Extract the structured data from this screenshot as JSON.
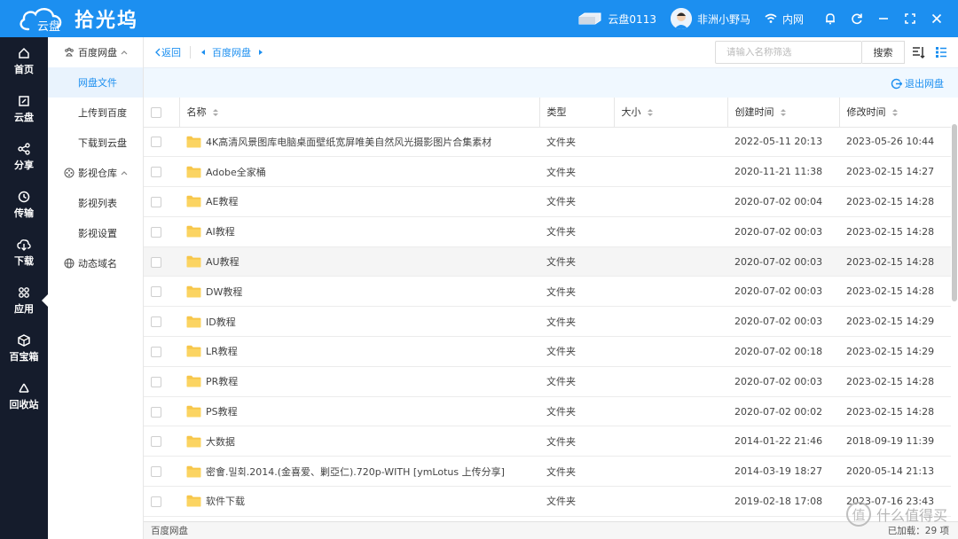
{
  "app": {
    "logo_text": "云盘",
    "title": "拾光坞"
  },
  "topbar": {
    "device_name": "云盘0113",
    "user_name": "非洲小野马",
    "network": "内网"
  },
  "leftnav": [
    {
      "label": "首页",
      "icon": "home-icon"
    },
    {
      "label": "云盘",
      "icon": "cloud-disk-icon"
    },
    {
      "label": "分享",
      "icon": "share-icon"
    },
    {
      "label": "传输",
      "icon": "transfer-icon"
    },
    {
      "label": "下载",
      "icon": "download-icon"
    },
    {
      "label": "应用",
      "icon": "apps-icon"
    },
    {
      "label": "百宝箱",
      "icon": "toolbox-icon"
    },
    {
      "label": "回收站",
      "icon": "recycle-icon"
    }
  ],
  "subnav": {
    "group1": "百度网盘",
    "items1": [
      "网盘文件",
      "上传到百度",
      "下载到云盘"
    ],
    "group2": "影视仓库",
    "items2": [
      "影视列表",
      "影视设置"
    ],
    "group3": "动态域名"
  },
  "toolbar": {
    "back": "返回",
    "crumb": "百度网盘",
    "search_placeholder": "请输入名称筛选",
    "search_button": "搜索",
    "exit_link": "退出网盘"
  },
  "table": {
    "headers": {
      "name": "名称",
      "type": "类型",
      "size": "大小",
      "created": "创建时间",
      "modified": "修改时间"
    },
    "rows": [
      {
        "name": "4K高清风景图库电脑桌面壁纸宽屏唯美自然风光摄影图片合集素材",
        "type": "文件夹",
        "size": "",
        "created": "2022-05-11 20:13",
        "modified": "2023-05-26 10:44"
      },
      {
        "name": "Adobe全家桶",
        "type": "文件夹",
        "size": "",
        "created": "2020-11-21 11:38",
        "modified": "2023-02-15 14:27"
      },
      {
        "name": "AE教程",
        "type": "文件夹",
        "size": "",
        "created": "2020-07-02 00:04",
        "modified": "2023-02-15 14:28"
      },
      {
        "name": "AI教程",
        "type": "文件夹",
        "size": "",
        "created": "2020-07-02 00:03",
        "modified": "2023-02-15 14:28"
      },
      {
        "name": "AU教程",
        "type": "文件夹",
        "size": "",
        "created": "2020-07-02 00:03",
        "modified": "2023-02-15 14:28"
      },
      {
        "name": "DW教程",
        "type": "文件夹",
        "size": "",
        "created": "2020-07-02 00:03",
        "modified": "2023-02-15 14:28"
      },
      {
        "name": "ID教程",
        "type": "文件夹",
        "size": "",
        "created": "2020-07-02 00:03",
        "modified": "2023-02-15 14:29"
      },
      {
        "name": "LR教程",
        "type": "文件夹",
        "size": "",
        "created": "2020-07-02 00:18",
        "modified": "2023-02-15 14:29"
      },
      {
        "name": "PR教程",
        "type": "文件夹",
        "size": "",
        "created": "2020-07-02 00:03",
        "modified": "2023-02-15 14:28"
      },
      {
        "name": "PS教程",
        "type": "文件夹",
        "size": "",
        "created": "2020-07-02 00:02",
        "modified": "2023-02-15 14:28"
      },
      {
        "name": "大数据",
        "type": "文件夹",
        "size": "",
        "created": "2014-01-22 21:46",
        "modified": "2018-09-19 11:39"
      },
      {
        "name": "密會.밀회.2014.(金喜爱、剿亞仁).720p-WITH [ymLotus 上传分享]",
        "type": "文件夹",
        "size": "",
        "created": "2014-03-19 18:27",
        "modified": "2020-05-14 21:13"
      },
      {
        "name": "软件下载",
        "type": "文件夹",
        "size": "",
        "created": "2019-02-18 17:08",
        "modified": "2023-07-16 23:43"
      }
    ]
  },
  "footer": {
    "path": "百度网盘",
    "loaded_label": "已加载：",
    "loaded_count": "29 项"
  },
  "watermark": {
    "badge": "值",
    "text": "什么值得买"
  },
  "colors": {
    "accent": "#1c8ff0",
    "nav_bg": "#151c2c",
    "folder": "#f7c64a"
  }
}
